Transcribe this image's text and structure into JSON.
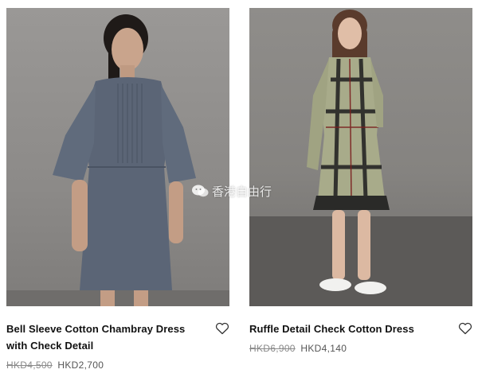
{
  "products": [
    {
      "name": "Bell Sleeve Cotton Chambray Dress with Check Detail",
      "original_price": "HKD4,500",
      "sale_price": "HKD2,700",
      "wishlist_icon": "heart-outline-icon"
    },
    {
      "name": "Ruffle Detail Check Cotton Dress",
      "original_price": "HKD6,900",
      "sale_price": "HKD4,140",
      "wishlist_icon": "heart-outline-icon"
    }
  ],
  "watermark": {
    "text": "香港自由行",
    "icon": "wechat-icon"
  },
  "colors": {
    "background": "#ffffff",
    "title_text": "#111111",
    "price_text": "#666666"
  }
}
